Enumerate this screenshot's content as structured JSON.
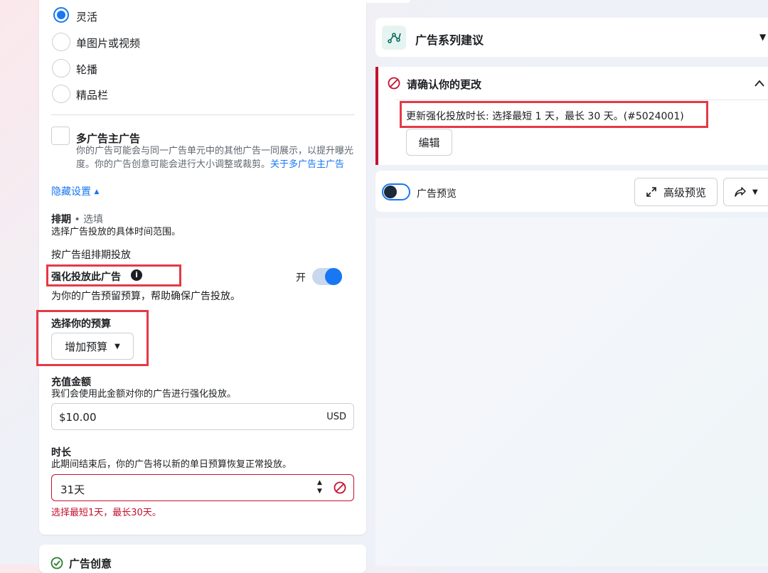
{
  "format": {
    "options": [
      {
        "label": "灵活",
        "selected": true
      },
      {
        "label": "单图片或视频",
        "selected": false
      },
      {
        "label": "轮播",
        "selected": false
      },
      {
        "label": "精品栏",
        "selected": false
      }
    ]
  },
  "multi_advertiser": {
    "title": "多广告主广告",
    "desc": "你的广告可能会与同一广告单元中的其他广告一同展示，以提升曝光度。你的广告创意可能会进行大小调整或裁剪。",
    "link": "关于多广告主广告"
  },
  "hide_settings": "隐藏设置",
  "schedule": {
    "title": "排期",
    "optional": "• 选填",
    "desc": "选择广告投放的具体时间范围。",
    "by_adset": "按广告组排期投放"
  },
  "boost": {
    "title": "强化投放此广告",
    "toggle_label": "开",
    "toggle_on": true,
    "desc": "为你的广告预留预算，帮助确保广告投放。"
  },
  "budget": {
    "title": "选择你的预算",
    "dropdown": "增加预算"
  },
  "amount": {
    "title": "充值金额",
    "desc": "我们会使用此金额对你的广告进行强化投放。",
    "value": "$10.00",
    "currency": "USD"
  },
  "duration": {
    "title": "时长",
    "desc": "此期间结束后，你的广告将以新的单日预算恢复正常投放。",
    "value": "31天",
    "error": "选择最短1天，最长30天。"
  },
  "creative_card": {
    "title": "广告创意"
  },
  "suggestions": {
    "title": "广告系列建议"
  },
  "confirm": {
    "title": "请确认你的更改",
    "message": "更新强化投放时长: 选择最短 1 天，最长 30 天。(#5024001)",
    "edit": "编辑"
  },
  "preview": {
    "label": "广告预览",
    "advanced": "高级预览"
  },
  "colors": {
    "accent": "#1877f2",
    "error": "#c41230",
    "highlight": "#e53946"
  }
}
